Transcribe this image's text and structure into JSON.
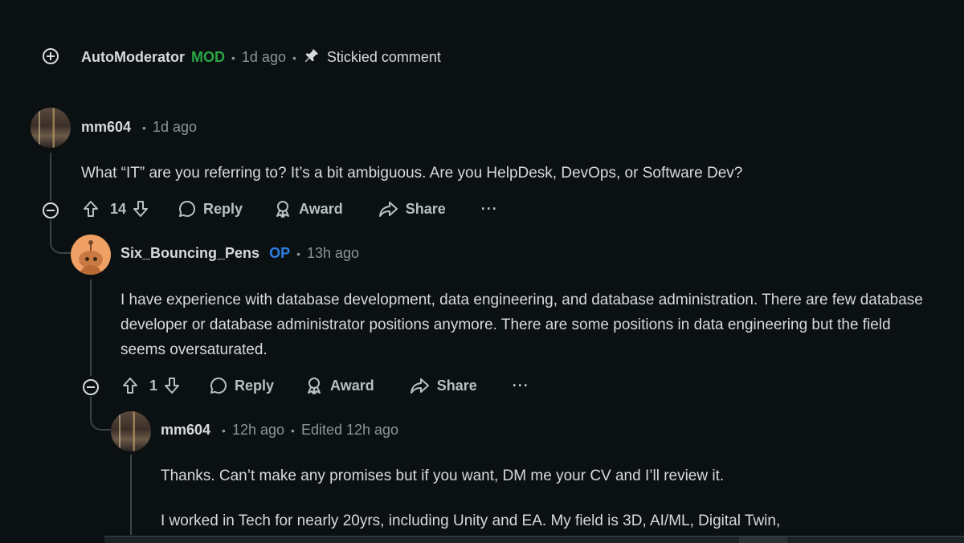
{
  "comments": [
    {
      "id": "c0",
      "username": "AutoModerator",
      "flair": "MOD",
      "time": "1d ago",
      "sticky_label": "Stickied comment",
      "collapsed": true
    },
    {
      "id": "c1",
      "username": "mm604",
      "time": "1d ago",
      "body": "What “IT” are you referring to? It’s a bit ambiguous. Are you HelpDesk, DevOps, or Software Dev?",
      "votes": "14",
      "reply_label": "Reply",
      "award_label": "Award",
      "share_label": "Share",
      "more_label": "···"
    },
    {
      "id": "c2",
      "username": "Six_Bouncing_Pens",
      "flair": "OP",
      "time": "13h ago",
      "body": "I have experience with database development, data engineering, and database administration. There are few database developer or database administrator positions anymore. There are some positions in data engineering but the field seems oversaturated.",
      "votes": "1",
      "reply_label": "Reply",
      "award_label": "Award",
      "share_label": "Share",
      "more_label": "···"
    },
    {
      "id": "c3",
      "username": "mm604",
      "time": "12h ago",
      "edited": "Edited 12h ago",
      "body_p1": "Thanks. Can’t make any promises but if you want, DM me your CV and I’ll review it.",
      "body_p2": "I worked in Tech for nearly 20yrs, including Unity and EA. My field is 3D, AI/ML, Digital Twin,"
    }
  ],
  "colors": {
    "background": "#0b1113",
    "mod": "#29a745",
    "op": "#2f7ee6",
    "text": "#d7dadc",
    "muted": "#8b969b"
  },
  "icons": [
    "plus-circle-icon",
    "minus-circle-icon",
    "pin-icon",
    "upvote-icon",
    "downvote-icon",
    "comment-bubble-icon",
    "award-icon",
    "share-icon",
    "more-icon"
  ]
}
